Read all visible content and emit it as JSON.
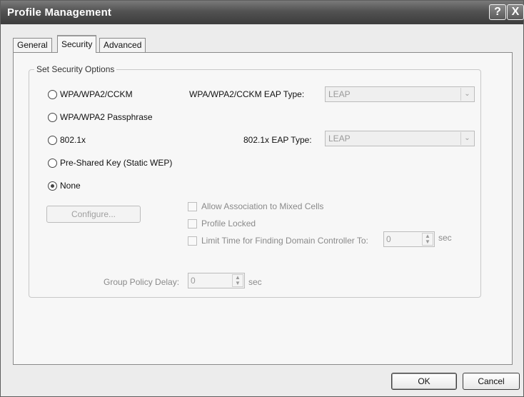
{
  "window": {
    "title": "Profile Management"
  },
  "titlebar_buttons": {
    "help": "?",
    "close": "X"
  },
  "tabs": [
    {
      "label": "General",
      "active": false
    },
    {
      "label": "Security",
      "active": true
    },
    {
      "label": "Advanced",
      "active": false
    }
  ],
  "security": {
    "group_label": "Set Security Options",
    "options": [
      {
        "label": "WPA/WPA2/CCKM",
        "checked": false
      },
      {
        "label": "WPA/WPA2 Passphrase",
        "checked": false
      },
      {
        "label": "802.1x",
        "checked": false
      },
      {
        "label": "Pre-Shared Key (Static WEP)",
        "checked": false
      },
      {
        "label": "None",
        "checked": true
      }
    ],
    "wpa_eap": {
      "label": "WPA/WPA2/CCKM EAP Type:",
      "value": "LEAP"
    },
    "dot1x_eap": {
      "label": "802.1x EAP Type:",
      "value": "LEAP"
    },
    "configure_label": "Configure...",
    "checkboxes": [
      {
        "label": "Allow Association to Mixed Cells",
        "checked": false
      },
      {
        "label": "Profile Locked",
        "checked": false
      },
      {
        "label": "Limit Time for Finding Domain Controller To:",
        "checked": false
      }
    ],
    "domain_timeout": {
      "value": "0",
      "unit": "sec"
    },
    "group_policy": {
      "label": "Group Policy Delay:",
      "value": "0",
      "unit": "sec"
    }
  },
  "footer": {
    "ok": "OK",
    "cancel": "Cancel"
  }
}
